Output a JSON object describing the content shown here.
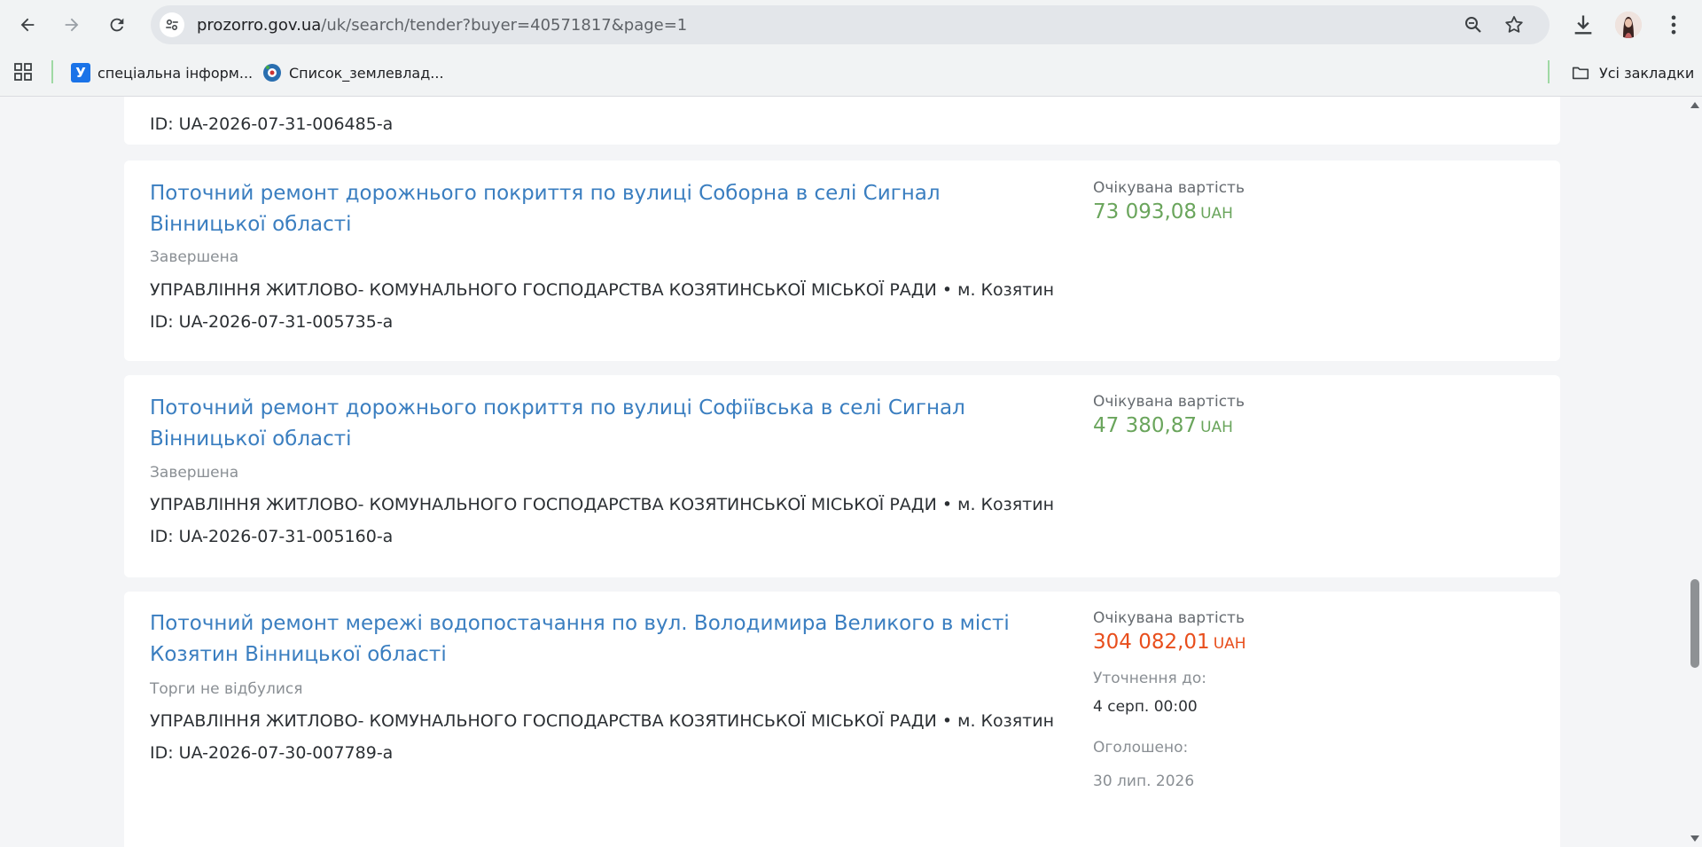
{
  "browser": {
    "url_host": "prozorro.gov.ua",
    "url_path": "/uk/search/tender?buyer=40571817&page=1"
  },
  "bookmarks": {
    "items": [
      {
        "label": "спеціальна інформ...",
        "icon": "u-favicon"
      },
      {
        "label": "Список_землевлад...",
        "icon": "wiki-favicon"
      }
    ],
    "all_label": "Усі закладки"
  },
  "prev_card": {
    "id": "ID: UA-2026-07-31-006485-a"
  },
  "tenders": [
    {
      "title": "Поточний ремонт дорожнього покриття по вулиці Соборна в селі Сигнал Вінницької області",
      "status": "Завершена",
      "buyer": "УПРАВЛІННЯ ЖИТЛОВО- КОМУНАЛЬНОГО ГОСПОДАРСТВА КОЗЯТИНСЬКОЇ МІСЬКОЇ РАДИ • м. Козятин",
      "id": "ID: UA-2026-07-31-005735-a",
      "expected_label": "Очікувана вартість",
      "amount": "73 093,08",
      "currency": "UAH",
      "amount_color": "#6aa55c"
    },
    {
      "title": "Поточний ремонт дорожнього покриття по вулиці Софіївська в селі Сигнал Вінницької області",
      "status": "Завершена",
      "buyer": "УПРАВЛІННЯ ЖИТЛОВО- КОМУНАЛЬНОГО ГОСПОДАРСТВА КОЗЯТИНСЬКОЇ МІСЬКОЇ РАДИ • м. Козятин",
      "id": "ID: UA-2026-07-31-005160-a",
      "expected_label": "Очікувана вартість",
      "amount": "47 380,87",
      "currency": "UAH",
      "amount_color": "#6aa55c"
    },
    {
      "title": "Поточний ремонт мережі водопостачання по вул. Володимира Великого в місті Козятин Вінницької області",
      "status": "Торги не відбулися",
      "buyer": "УПРАВЛІННЯ ЖИТЛОВО- КОМУНАЛЬНОГО ГОСПОДАРСТВА КОЗЯТИНСЬКОЇ МІСЬКОЇ РАДИ • м. Козятин",
      "id": "ID: UA-2026-07-30-007789-a",
      "expected_label": "Очікувана вартість",
      "amount": "304 082,01",
      "currency": "UAH",
      "amount_color": "#e84e1c",
      "clarify_label": "Уточнення до:",
      "clarify_value": "4 серп. 00:00",
      "announced_label": "Оголошено:",
      "announced_value": "30 лип. 2026"
    }
  ]
}
